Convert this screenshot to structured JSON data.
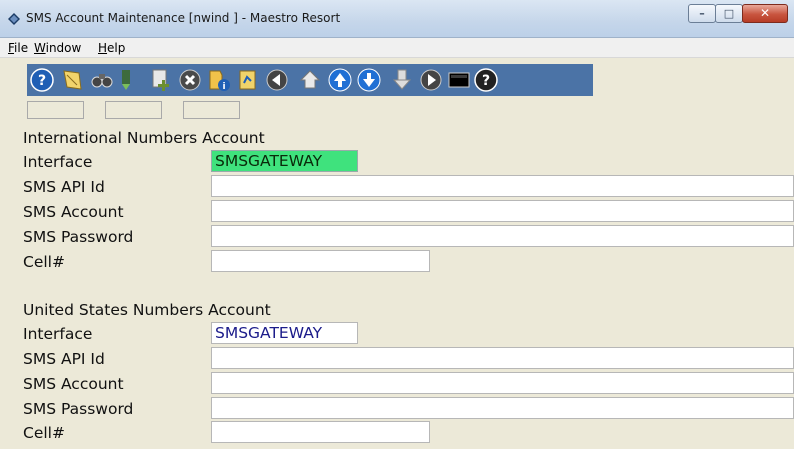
{
  "window": {
    "title": "SMS Account Maintenance [nwind   ] - Maestro Resort",
    "controls": [
      "minimize",
      "maximize",
      "close"
    ]
  },
  "menu": {
    "items": [
      {
        "label": "File",
        "accel": "F"
      },
      {
        "label": "Window",
        "accel": "W"
      },
      {
        "label": "Help",
        "accel": "H"
      }
    ]
  },
  "toolbar": {
    "icons": [
      "help-icon",
      "note-icon",
      "binoculars-icon",
      "bookmark-icon",
      "add-icon",
      "delete-icon",
      "info-icon",
      "report-icon",
      "back-icon",
      "home-icon",
      "up-icon",
      "down-icon",
      "down-disabled-icon",
      "forward-icon",
      "terminal-icon",
      "help-circle-icon"
    ]
  },
  "colors": {
    "accent_green": "#3fe27d",
    "toolbar_strip": "#4b73a6"
  },
  "international": {
    "heading": "International Numbers Account",
    "interface_label": "Interface",
    "interface_value": "SMSGATEWAY",
    "api_label": "SMS API Id",
    "api_value": "",
    "account_label": "SMS Account",
    "account_value": "",
    "password_label": "SMS Password",
    "password_value": "",
    "cell_label": "Cell#",
    "cell_value": ""
  },
  "us": {
    "heading": "United States Numbers Account",
    "interface_label": "Interface",
    "interface_value": "SMSGATEWAY",
    "api_label": "SMS API Id",
    "api_value": "",
    "account_label": "SMS Account",
    "account_value": "",
    "password_label": "SMS Password",
    "password_value": "",
    "cell_label": "Cell#",
    "cell_value": ""
  }
}
